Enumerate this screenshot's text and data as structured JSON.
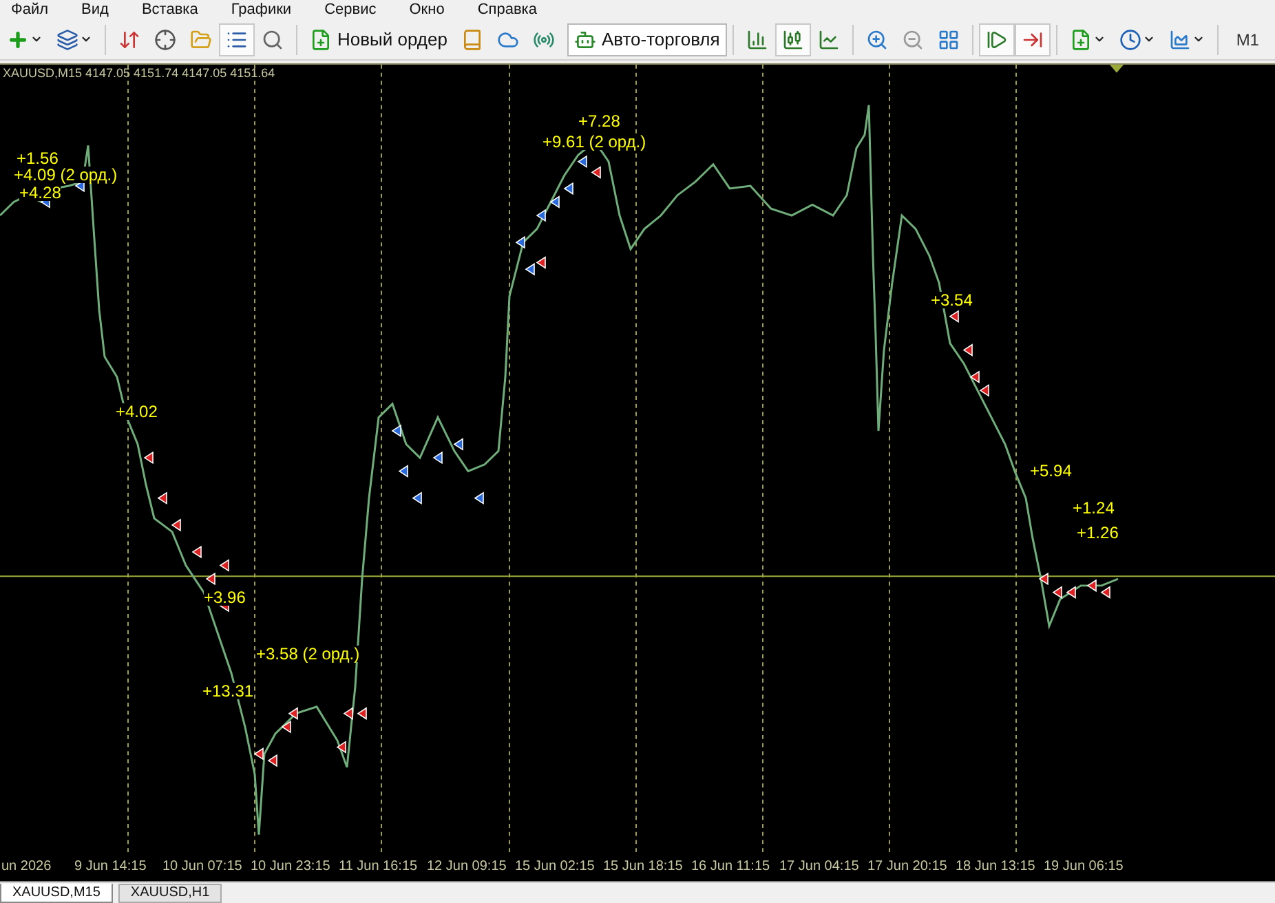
{
  "menu": [
    "Файл",
    "Вид",
    "Вставка",
    "Графики",
    "Сервис",
    "Окно",
    "Справка"
  ],
  "toolbar": {
    "new_order": "Новый ордер",
    "autotrading": "Авто-торговля",
    "timeframe": "M1",
    "navigator_pressed": true,
    "chart_types": [
      {
        "kind": "bars",
        "selected": false
      },
      {
        "kind": "candles",
        "selected": true
      },
      {
        "kind": "line",
        "selected": false
      }
    ],
    "auto_scroll": true,
    "chart_shift": true
  },
  "chart": {
    "header": "XAUUSD,M15  4147.05 4151.74 4147.05 4151.64",
    "trade_labels": [
      {
        "text": "+1.56"
      },
      {
        "text": "+4.09 (2 орд.)"
      },
      {
        "text": "+4.28"
      },
      {
        "text": "+4.02"
      },
      {
        "text": "+3.96"
      },
      {
        "text": "+3.58 (2 орд.)"
      },
      {
        "text": "+13.31"
      },
      {
        "text": "+7.28"
      },
      {
        "text": "+9.61 (2 орд.)"
      },
      {
        "text": "+3.54"
      },
      {
        "text": "+5.94"
      },
      {
        "text": "+1.24"
      },
      {
        "text": "+1.26"
      }
    ],
    "time_axis": [
      "un 2026",
      "9 Jun 14:15",
      "10 Jun 07:15",
      "10 Jun 23:15",
      "11 Jun 16:15",
      "12 Jun 09:15",
      "15 Jun 02:15",
      "15 Jun 18:15",
      "16 Jun 11:15",
      "17 Jun 04:15",
      "17 Jun 20:15",
      "18 Jun 13:15",
      "19 Jun 06:15"
    ]
  },
  "tabs": [
    {
      "label": "XAUUSD,M15",
      "selected": true
    },
    {
      "label": "XAUUSD,H1",
      "selected": false
    }
  ]
}
